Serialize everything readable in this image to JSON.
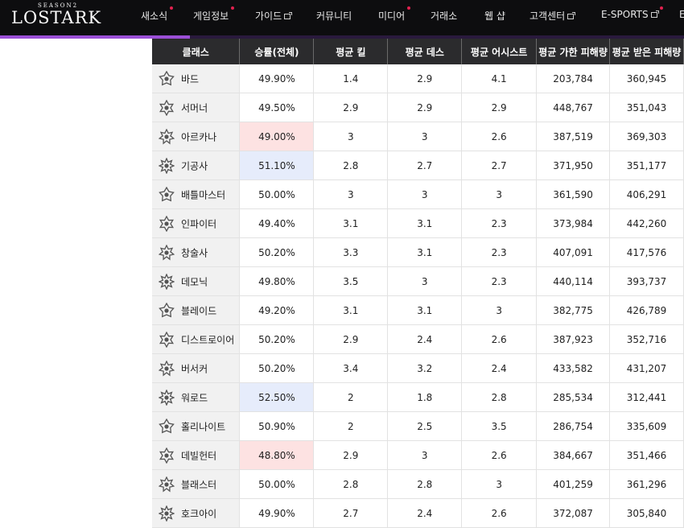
{
  "brand": {
    "season_label": "SEASON2",
    "logo_text": "LOSTARK"
  },
  "nav": {
    "items": [
      {
        "label": "새소식",
        "dot": true,
        "external": false
      },
      {
        "label": "게임정보",
        "dot": true,
        "external": false
      },
      {
        "label": "가이드",
        "dot": false,
        "external": true
      },
      {
        "label": "커뮤니티",
        "dot": false,
        "external": false
      },
      {
        "label": "미디어",
        "dot": true,
        "external": false
      },
      {
        "label": "거래소",
        "dot": false,
        "external": false
      },
      {
        "label": "웹 샵",
        "dot": false,
        "external": false
      },
      {
        "label": "고객센터",
        "dot": false,
        "external": true
      },
      {
        "label": "E-SPORTS",
        "dot": true,
        "external": true
      }
    ],
    "overflow_text": "E"
  },
  "table": {
    "headers": [
      "클래스",
      "승률(전체)",
      "평균 킬",
      "평균 데스",
      "평균 어시스트",
      "평균 가한 피해량",
      "평균 받은 피해량"
    ],
    "rows": [
      {
        "icon": "bard-class-icon",
        "name": "바드",
        "winrate": "49.90%",
        "kills": "1.4",
        "deaths": "2.9",
        "assists": "4.1",
        "dealt": "203,784",
        "taken": "360,945",
        "highlight": ""
      },
      {
        "icon": "summoner-class-icon",
        "name": "서머너",
        "winrate": "49.50%",
        "kills": "2.9",
        "deaths": "2.9",
        "assists": "2.9",
        "dealt": "448,767",
        "taken": "351,043",
        "highlight": ""
      },
      {
        "icon": "arcana-class-icon",
        "name": "아르카나",
        "winrate": "49.00%",
        "kills": "3",
        "deaths": "3",
        "assists": "2.6",
        "dealt": "387,519",
        "taken": "369,303",
        "highlight": "red"
      },
      {
        "icon": "soulfist-class-icon",
        "name": "기공사",
        "winrate": "51.10%",
        "kills": "2.8",
        "deaths": "2.7",
        "assists": "2.7",
        "dealt": "371,950",
        "taken": "351,177",
        "highlight": "blue"
      },
      {
        "icon": "wardancer-class-icon",
        "name": "배틀마스터",
        "winrate": "50.00%",
        "kills": "3",
        "deaths": "3",
        "assists": "3",
        "dealt": "361,590",
        "taken": "406,291",
        "highlight": ""
      },
      {
        "icon": "scrapper-class-icon",
        "name": "인파이터",
        "winrate": "49.40%",
        "kills": "3.1",
        "deaths": "3.1",
        "assists": "2.3",
        "dealt": "373,984",
        "taken": "442,260",
        "highlight": ""
      },
      {
        "icon": "glaivier-class-icon",
        "name": "창술사",
        "winrate": "50.20%",
        "kills": "3.3",
        "deaths": "3.1",
        "assists": "2.3",
        "dealt": "407,091",
        "taken": "417,576",
        "highlight": ""
      },
      {
        "icon": "shadowhunter-class-icon",
        "name": "데모닉",
        "winrate": "49.80%",
        "kills": "3.5",
        "deaths": "3",
        "assists": "2.3",
        "dealt": "440,114",
        "taken": "393,737",
        "highlight": ""
      },
      {
        "icon": "deathblade-class-icon",
        "name": "블레이드",
        "winrate": "49.20%",
        "kills": "3.1",
        "deaths": "3.1",
        "assists": "3",
        "dealt": "382,775",
        "taken": "426,789",
        "highlight": ""
      },
      {
        "icon": "destroyer-class-icon",
        "name": "디스트로이어",
        "winrate": "50.20%",
        "kills": "2.9",
        "deaths": "2.4",
        "assists": "2.6",
        "dealt": "387,923",
        "taken": "352,716",
        "highlight": ""
      },
      {
        "icon": "berserker-class-icon",
        "name": "버서커",
        "winrate": "50.20%",
        "kills": "3.4",
        "deaths": "3.2",
        "assists": "2.4",
        "dealt": "433,582",
        "taken": "431,207",
        "highlight": ""
      },
      {
        "icon": "gunlancer-class-icon",
        "name": "워로드",
        "winrate": "52.50%",
        "kills": "2",
        "deaths": "1.8",
        "assists": "2.8",
        "dealt": "285,534",
        "taken": "312,441",
        "highlight": "blue"
      },
      {
        "icon": "paladin-class-icon",
        "name": "홀리나이트",
        "winrate": "50.90%",
        "kills": "2",
        "deaths": "2.5",
        "assists": "3.5",
        "dealt": "286,754",
        "taken": "335,609",
        "highlight": ""
      },
      {
        "icon": "gunslinger-class-icon",
        "name": "데빌헌터",
        "winrate": "48.80%",
        "kills": "2.9",
        "deaths": "3",
        "assists": "2.6",
        "dealt": "384,667",
        "taken": "351,466",
        "highlight": "red"
      },
      {
        "icon": "artillerist-class-icon",
        "name": "블래스터",
        "winrate": "50.00%",
        "kills": "2.8",
        "deaths": "2.8",
        "assists": "3",
        "dealt": "401,259",
        "taken": "361,296",
        "highlight": ""
      },
      {
        "icon": "sharpshooter-class-icon",
        "name": "호크아이",
        "winrate": "49.90%",
        "kills": "2.7",
        "deaths": "2.4",
        "assists": "2.6",
        "dealt": "372,087",
        "taken": "305,840",
        "highlight": ""
      }
    ]
  },
  "colors": {
    "header_bg": "#2b2b2d",
    "nav_bg": "#0d0d0f",
    "accent_purple": "#9b4fd6",
    "dot_red": "#e2214f",
    "highlight_red": "#fde2e2",
    "highlight_blue": "#e6ecfb"
  }
}
